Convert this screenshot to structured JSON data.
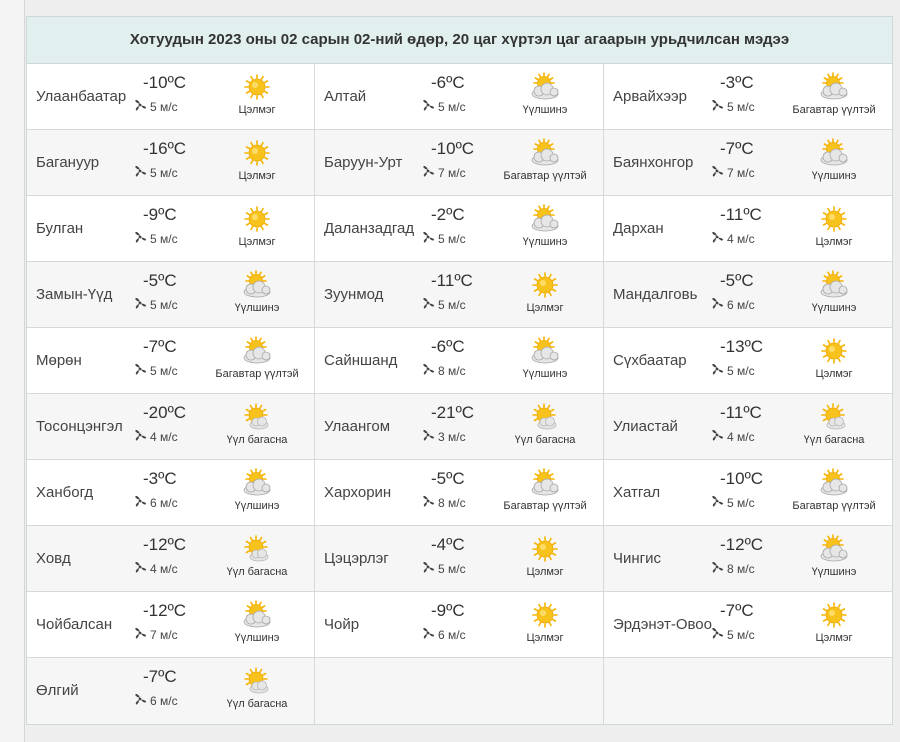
{
  "title": "Хотуудын 2023 оны 02 сарын 02-ний өдөр, 20 цаг хүртэл цаг агаарын урьдчилсан мэдээ",
  "temp_unit": "ºC",
  "wind_unit": "м/с",
  "cities": [
    {
      "name": "Улаанбаатар",
      "temp": "-10",
      "wind": "5",
      "cond": "Цэлмэг",
      "icon": "sun-icon"
    },
    {
      "name": "Алтай",
      "temp": "-6",
      "wind": "5",
      "cond": "Үүлшинэ",
      "icon": "sun-cloud-icon"
    },
    {
      "name": "Арвайхээр",
      "temp": "-3",
      "wind": "5",
      "cond": "Багавтар үүлтэй",
      "icon": "sun-cloud-icon"
    },
    {
      "name": "Багануур",
      "temp": "-16",
      "wind": "5",
      "cond": "Цэлмэг",
      "icon": "sun-icon"
    },
    {
      "name": "Баруун-Урт",
      "temp": "-10",
      "wind": "7",
      "cond": "Багавтар үүлтэй",
      "icon": "sun-cloud-icon"
    },
    {
      "name": "Баянхонгор",
      "temp": "-7",
      "wind": "7",
      "cond": "Үүлшинэ",
      "icon": "sun-cloud-icon"
    },
    {
      "name": "Булган",
      "temp": "-9",
      "wind": "5",
      "cond": "Цэлмэг",
      "icon": "sun-icon"
    },
    {
      "name": "Даланзадгад",
      "temp": "-2",
      "wind": "5",
      "cond": "Үүлшинэ",
      "icon": "sun-cloud-icon"
    },
    {
      "name": "Дархан",
      "temp": "-11",
      "wind": "4",
      "cond": "Цэлмэг",
      "icon": "sun-icon"
    },
    {
      "name": "Замын-Үүд",
      "temp": "-5",
      "wind": "5",
      "cond": "Үүлшинэ",
      "icon": "sun-cloud-icon"
    },
    {
      "name": "Зуунмод",
      "temp": "-11",
      "wind": "5",
      "cond": "Цэлмэг",
      "icon": "sun-icon"
    },
    {
      "name": "Мандалговь",
      "temp": "-5",
      "wind": "6",
      "cond": "Үүлшинэ",
      "icon": "sun-cloud-icon"
    },
    {
      "name": "Мөрөн",
      "temp": "-7",
      "wind": "5",
      "cond": "Багавтар үүлтэй",
      "icon": "sun-cloud-icon"
    },
    {
      "name": "Сайншанд",
      "temp": "-6",
      "wind": "8",
      "cond": "Үүлшинэ",
      "icon": "sun-cloud-icon"
    },
    {
      "name": "Сүхбаатар",
      "temp": "-13",
      "wind": "5",
      "cond": "Цэлмэг",
      "icon": "sun-icon"
    },
    {
      "name": "Тосонцэнгэл",
      "temp": "-20",
      "wind": "4",
      "cond": "Үүл багасна",
      "icon": "sun-small-cloud-icon"
    },
    {
      "name": "Улаангом",
      "temp": "-21",
      "wind": "3",
      "cond": "Үүл багасна",
      "icon": "sun-small-cloud-icon"
    },
    {
      "name": "Улиастай",
      "temp": "-11",
      "wind": "4",
      "cond": "Үүл багасна",
      "icon": "sun-small-cloud-icon"
    },
    {
      "name": "Ханбогд",
      "temp": "-3",
      "wind": "6",
      "cond": "Үүлшинэ",
      "icon": "sun-cloud-icon"
    },
    {
      "name": "Хархорин",
      "temp": "-5",
      "wind": "8",
      "cond": "Багавтар үүлтэй",
      "icon": "sun-cloud-icon"
    },
    {
      "name": "Хатгал",
      "temp": "-10",
      "wind": "5",
      "cond": "Багавтар үүлтэй",
      "icon": "sun-cloud-icon"
    },
    {
      "name": "Ховд",
      "temp": "-12",
      "wind": "4",
      "cond": "Үүл багасна",
      "icon": "sun-small-cloud-icon"
    },
    {
      "name": "Цэцэрлэг",
      "temp": "-4",
      "wind": "5",
      "cond": "Цэлмэг",
      "icon": "sun-icon"
    },
    {
      "name": "Чингис",
      "temp": "-12",
      "wind": "8",
      "cond": "Үүлшинэ",
      "icon": "sun-cloud-icon"
    },
    {
      "name": "Чойбалсан",
      "temp": "-12",
      "wind": "7",
      "cond": "Үүлшинэ",
      "icon": "sun-cloud-icon"
    },
    {
      "name": "Чойр",
      "temp": "-9",
      "wind": "6",
      "cond": "Цэлмэг",
      "icon": "sun-icon"
    },
    {
      "name": "Эрдэнэт-Овоо",
      "temp": "-7",
      "wind": "5",
      "cond": "Цэлмэг",
      "icon": "sun-icon"
    },
    {
      "name": "Өлгий",
      "temp": "-7",
      "wind": "6",
      "cond": "Үүл багасна",
      "icon": "sun-small-cloud-icon"
    }
  ],
  "colors": {
    "header_bg": "#e1efef",
    "sun": "#f7c21b",
    "cloud": "#e6e6e6"
  }
}
